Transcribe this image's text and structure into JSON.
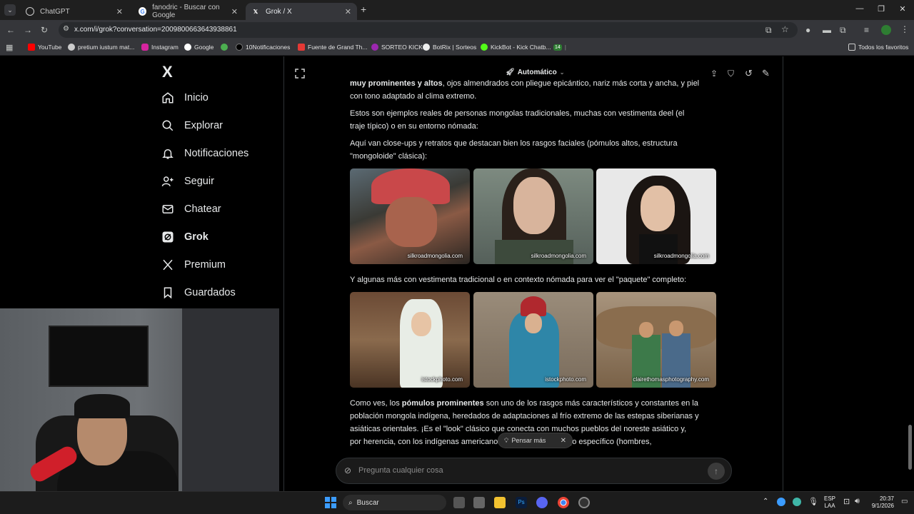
{
  "browser": {
    "tabs": [
      {
        "label": "ChatGPT",
        "active": false
      },
      {
        "label": "fanodric - Buscar con Google",
        "active": false
      },
      {
        "label": "Grok / X",
        "active": true
      }
    ],
    "url": "x.com/i/grok?conversation=2009800663643938861",
    "bookmarks": [
      "YouTube",
      "pretium iustum mat...",
      "Instagram",
      "Google",
      "10Notificaciones",
      "Fuente de Grand Th...",
      "SORTEO KICK",
      "BotRix | Sorteos",
      "KickBot - Kick Chatb...",
      "Todos los favoritos"
    ],
    "bookmark_badge": "14"
  },
  "sidebar": {
    "logo": "X",
    "items": [
      {
        "label": "Inicio",
        "icon": "home-icon"
      },
      {
        "label": "Explorar",
        "icon": "search-icon"
      },
      {
        "label": "Notificaciones",
        "icon": "bell-icon"
      },
      {
        "label": "Seguir",
        "icon": "follow-icon"
      },
      {
        "label": "Chatear",
        "icon": "mail-icon"
      },
      {
        "label": "Grok",
        "icon": "grok-icon"
      },
      {
        "label": "Premium",
        "icon": "x-icon"
      },
      {
        "label": "Guardados",
        "icon": "bookmark-icon"
      }
    ]
  },
  "header": {
    "mode_label": "Automático"
  },
  "chat": {
    "p1_bold": "muy prominentes y altos",
    "p1_rest": ", ojos almendrados con pliegue epicántico, nariz más corta y ancha, y piel con tono adaptado al clima extremo.",
    "p2": "Estos son ejemplos reales de personas mongolas tradicionales, muchas con vestimenta deel (el traje típico) o en su entorno nómada:",
    "p3": "Aquí van close-ups y retratos que destacan bien los rasgos faciales (pómulos altos, estructura \"mongoloide\" clásica):",
    "images_row1": [
      {
        "caption": "silkroadmongolia.com"
      },
      {
        "caption": "silkroadmongolia.com"
      },
      {
        "caption": "silkroadmongolia.com"
      }
    ],
    "p4": "Y algunas más con vestimenta tradicional o en contexto nómada para ver el \"paquete\" completo:",
    "images_row2": [
      {
        "caption": "istockphoto.com"
      },
      {
        "caption": "istockphoto.com"
      },
      {
        "caption": "clairethomasphotography.com"
      }
    ],
    "p5_a": "Como ves, los ",
    "p5_bold": "pómulos prominentes",
    "p5_b": " son uno de los rasgos más característicos y constantes en la población mongola indígena, heredados de adaptaciones al frío extremo de las estepas siberianas y asiáticas orientales. ¡Es el \"look\" clásico que conecta con muchos pueblos del noreste asiático y, por herencia, con los indígenas americanos! ",
    "p5_c": "s enfocadas en algo específico (hombres,",
    "think_more": "Pensar más"
  },
  "input": {
    "placeholder": "Pregunta cualquier cosa"
  },
  "taskbar": {
    "search_label": "Buscar",
    "lang_top": "ESP",
    "lang_bottom": "LAA",
    "time": "20:37",
    "date": "9/1/2026"
  }
}
